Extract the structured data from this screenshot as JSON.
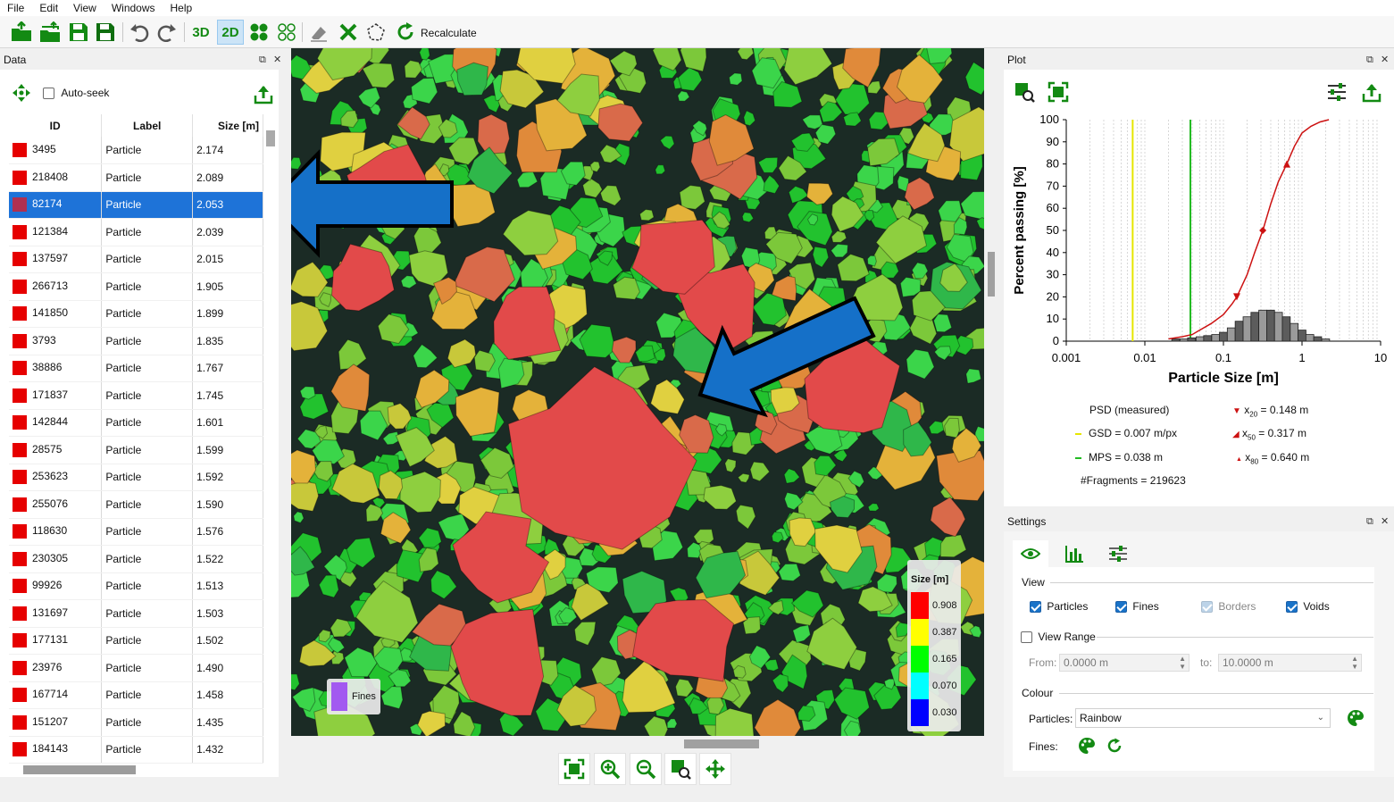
{
  "menu": [
    "File",
    "Edit",
    "View",
    "Windows",
    "Help"
  ],
  "toolbar": {
    "btn_3d": "3D",
    "btn_2d": "2D",
    "recalculate": "Recalculate"
  },
  "data_panel": {
    "title": "Data",
    "auto_seek": "Auto-seek",
    "auto_seek_checked": false,
    "columns": [
      "ID",
      "Label",
      "Size [m]"
    ],
    "rows": [
      {
        "id": "3495",
        "label": "Particle",
        "size": "2.174"
      },
      {
        "id": "218408",
        "label": "Particle",
        "size": "2.089"
      },
      {
        "id": "82174",
        "label": "Particle",
        "size": "2.053"
      },
      {
        "id": "121384",
        "label": "Particle",
        "size": "2.039"
      },
      {
        "id": "137597",
        "label": "Particle",
        "size": "2.015"
      },
      {
        "id": "266713",
        "label": "Particle",
        "size": "1.905"
      },
      {
        "id": "141850",
        "label": "Particle",
        "size": "1.899"
      },
      {
        "id": "3793",
        "label": "Particle",
        "size": "1.835"
      },
      {
        "id": "38886",
        "label": "Particle",
        "size": "1.767"
      },
      {
        "id": "171837",
        "label": "Particle",
        "size": "1.745"
      },
      {
        "id": "142844",
        "label": "Particle",
        "size": "1.601"
      },
      {
        "id": "28575",
        "label": "Particle",
        "size": "1.599"
      },
      {
        "id": "253623",
        "label": "Particle",
        "size": "1.592"
      },
      {
        "id": "255076",
        "label": "Particle",
        "size": "1.590"
      },
      {
        "id": "118630",
        "label": "Particle",
        "size": "1.576"
      },
      {
        "id": "230305",
        "label": "Particle",
        "size": "1.522"
      },
      {
        "id": "99926",
        "label": "Particle",
        "size": "1.513"
      },
      {
        "id": "131697",
        "label": "Particle",
        "size": "1.503"
      },
      {
        "id": "177131",
        "label": "Particle",
        "size": "1.502"
      },
      {
        "id": "23976",
        "label": "Particle",
        "size": "1.490"
      },
      {
        "id": "167714",
        "label": "Particle",
        "size": "1.458"
      },
      {
        "id": "151207",
        "label": "Particle",
        "size": "1.435"
      },
      {
        "id": "184143",
        "label": "Particle",
        "size": "1.432"
      }
    ],
    "selected_id": "82174"
  },
  "viewer": {
    "legend_title": "Size [m]",
    "legend": [
      {
        "value": "0.908",
        "color": "#ff0000"
      },
      {
        "value": "0.387",
        "color": "#ffff00"
      },
      {
        "value": "0.165",
        "color": "#00ff00"
      },
      {
        "value": "0.070",
        "color": "#00ffff"
      },
      {
        "value": "0.030",
        "color": "#0000ff"
      }
    ],
    "fines_label": "Fines",
    "fines_color": "#a259f0"
  },
  "plot_panel": {
    "title": "Plot",
    "stats": {
      "psd": "PSD (measured)",
      "gsd": "GSD = 0.007 m/px",
      "mps": "MPS = 0.038 m",
      "fragments": "#Fragments = 219623",
      "x20_label": "x",
      "x20_sub": "20",
      "x20_val": " = 0.148 m",
      "x50_label": "x",
      "x50_sub": "50",
      "x50_val": " = 0.317 m",
      "x80_label": "x",
      "x80_sub": "80",
      "x80_val": " = 0.640 m"
    }
  },
  "chart_data": {
    "type": "line",
    "xlabel": "Particle Size [m]",
    "ylabel": "Percent passing [%]",
    "xscale": "log",
    "xlim": [
      0.001,
      10
    ],
    "ylim": [
      0,
      100
    ],
    "x_ticks": [
      "0.001",
      "0.01",
      "0.1",
      "1",
      "10"
    ],
    "y_ticks": [
      "0",
      "10",
      "20",
      "30",
      "40",
      "50",
      "60",
      "70",
      "80",
      "90",
      "100"
    ],
    "series": [
      {
        "type": "line",
        "color": "#cc1111",
        "x": [
          0.02,
          0.03,
          0.04,
          0.05,
          0.07,
          0.1,
          0.13,
          0.148,
          0.2,
          0.25,
          0.317,
          0.4,
          0.5,
          0.64,
          0.8,
          1.0,
          1.3,
          1.7,
          2.2
        ],
        "y": [
          1,
          2,
          3,
          5,
          8,
          12,
          17,
          20,
          30,
          40,
          50,
          62,
          72,
          80,
          88,
          94,
          97,
          99,
          100
        ]
      },
      {
        "type": "bar",
        "color": "#666666",
        "x": [
          0.022,
          0.028,
          0.035,
          0.045,
          0.056,
          0.071,
          0.089,
          0.112,
          0.141,
          0.178,
          0.224,
          0.282,
          0.355,
          0.447,
          0.562,
          0.708,
          0.891,
          1.12,
          1.41,
          1.78
        ],
        "y": [
          1,
          1,
          1.5,
          2,
          2.5,
          3,
          4,
          6,
          9,
          11,
          13,
          14,
          14,
          13,
          11,
          8,
          5,
          3,
          2,
          1
        ]
      }
    ],
    "vlines": [
      {
        "x": 0.007,
        "color": "#e6e600"
      },
      {
        "x": 0.038,
        "color": "#22bb22"
      }
    ],
    "markers": [
      {
        "x": 0.148,
        "y": 20,
        "shape": "triangle-down"
      },
      {
        "x": 0.317,
        "y": 50,
        "shape": "diamond"
      },
      {
        "x": 0.64,
        "y": 80,
        "shape": "triangle-up"
      }
    ]
  },
  "settings_panel": {
    "title": "Settings",
    "view_heading": "View",
    "particles": "Particles",
    "fines": "Fines",
    "borders": "Borders",
    "voids": "Voids",
    "view_range": "View Range",
    "from_label": "From:",
    "from_value": "0.0000 m",
    "to_label": "to:",
    "to_value": "10.0000 m",
    "colour_heading": "Colour",
    "particles_colour_label": "Particles:",
    "particles_colour_value": "Rainbow",
    "fines_colour_label": "Fines:"
  }
}
